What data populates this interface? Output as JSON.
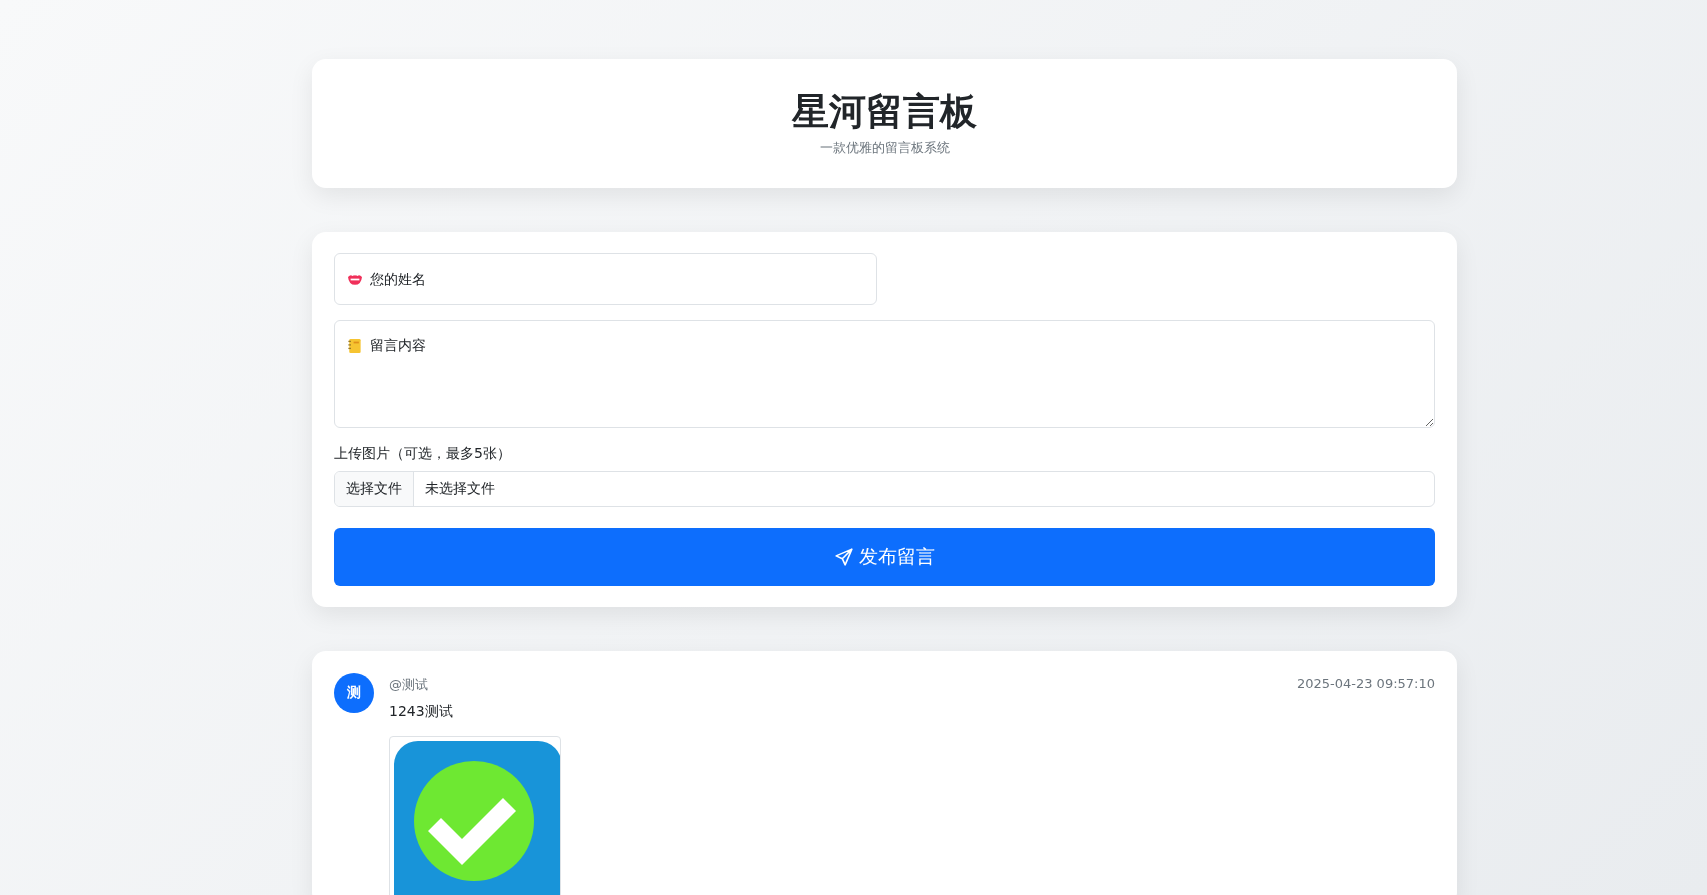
{
  "header": {
    "title": "星河留言板",
    "subtitle": "一款优雅的留言板系统"
  },
  "form": {
    "name_field": {
      "placeholder": "您的姓名"
    },
    "message_field": {
      "placeholder": "留言内容"
    },
    "upload_label": "上传图片（可选，最多5张）",
    "file_button": "选择文件",
    "file_status": "未选择文件",
    "submit_button": "发布留言"
  },
  "messages": [
    {
      "avatar": "测",
      "author": "@测试",
      "time": "2025-04-23 09:57:10",
      "text": "1243测试"
    }
  ]
}
